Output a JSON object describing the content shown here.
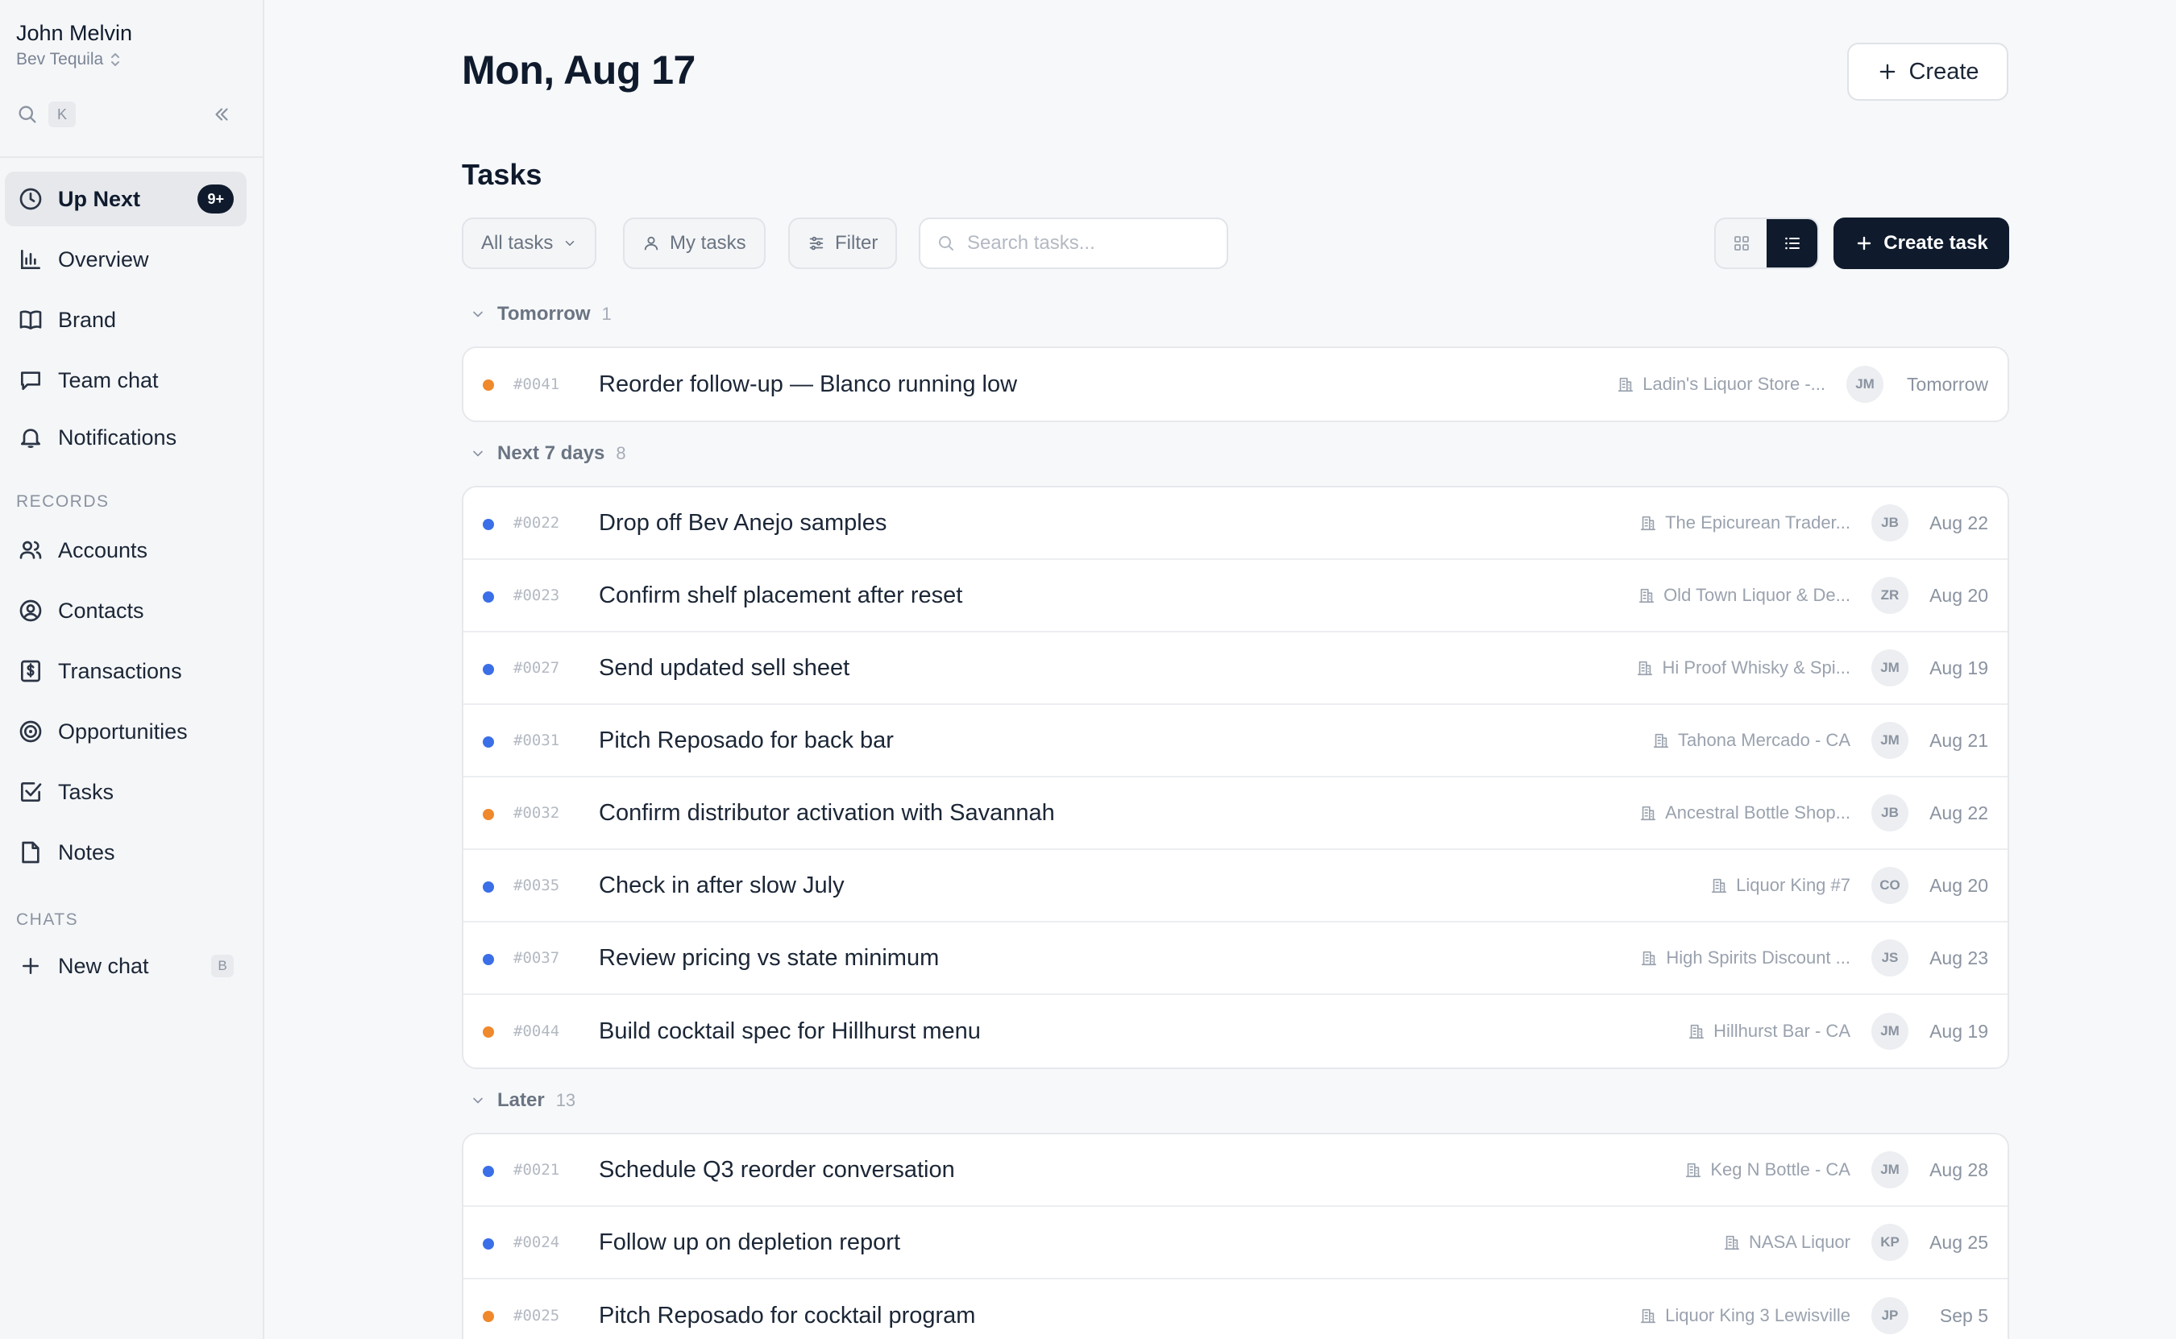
{
  "sidebar": {
    "user_name": "John Melvin",
    "workspace": "Bev Tequila",
    "search_shortcut": "K",
    "nav": [
      {
        "label": "Up Next",
        "icon": "clock-icon",
        "badge": "9+",
        "active": true
      },
      {
        "label": "Overview",
        "icon": "bar-chart-icon"
      },
      {
        "label": "Brand",
        "icon": "book-icon"
      },
      {
        "label": "Team chat",
        "icon": "chat-bubble-icon"
      },
      {
        "label": "Notifications",
        "icon": "bell-icon"
      }
    ],
    "records_label": "RECORDS",
    "records": [
      {
        "label": "Accounts",
        "icon": "users-icon"
      },
      {
        "label": "Contacts",
        "icon": "user-circle-icon"
      },
      {
        "label": "Transactions",
        "icon": "dollar-receipt-icon"
      },
      {
        "label": "Opportunities",
        "icon": "target-icon"
      },
      {
        "label": "Tasks",
        "icon": "checkbox-icon"
      },
      {
        "label": "Notes",
        "icon": "note-icon"
      }
    ],
    "chats_label": "CHATS",
    "new_chat": {
      "label": "New chat",
      "shortcut": "B"
    }
  },
  "header": {
    "date_title": "Mon, Aug 17",
    "create_label": "Create"
  },
  "tasks": {
    "title": "Tasks",
    "toolbar": {
      "all_tasks": "All tasks",
      "my_tasks": "My tasks",
      "filter": "Filter",
      "search_placeholder": "Search tasks...",
      "create_task": "Create task",
      "view_mode": "list"
    },
    "groups": [
      {
        "name": "Tomorrow",
        "count": "1",
        "rows": [
          {
            "id": "#0041",
            "title": "Reorder follow-up — Blanco running low",
            "account": "Ladin's Liquor Store -...",
            "assignee": "JM",
            "due": "Tomorrow",
            "priority": "high"
          }
        ]
      },
      {
        "name": "Next 7 days",
        "count": "8",
        "rows": [
          {
            "id": "#0022",
            "title": "Drop off Bev Anejo samples",
            "account": "The Epicurean Trader...",
            "assignee": "JB",
            "due": "Aug 22",
            "priority": "normal"
          },
          {
            "id": "#0023",
            "title": "Confirm shelf placement after reset",
            "account": "Old Town Liquor & De...",
            "assignee": "ZR",
            "due": "Aug 20",
            "priority": "normal"
          },
          {
            "id": "#0027",
            "title": "Send updated sell sheet",
            "account": "Hi Proof Whisky & Spi...",
            "assignee": "JM",
            "due": "Aug 19",
            "priority": "normal"
          },
          {
            "id": "#0031",
            "title": "Pitch Reposado for back bar",
            "account": "Tahona Mercado - CA",
            "assignee": "JM",
            "due": "Aug 21",
            "priority": "normal"
          },
          {
            "id": "#0032",
            "title": "Confirm distributor activation with Savannah",
            "account": "Ancestral Bottle Shop...",
            "assignee": "JB",
            "due": "Aug 22",
            "priority": "high"
          },
          {
            "id": "#0035",
            "title": "Check in after slow July",
            "account": "Liquor King #7",
            "assignee": "CO",
            "due": "Aug 20",
            "priority": "normal"
          },
          {
            "id": "#0037",
            "title": "Review pricing vs state minimum",
            "account": "High Spirits Discount ...",
            "assignee": "JS",
            "due": "Aug 23",
            "priority": "normal"
          },
          {
            "id": "#0044",
            "title": "Build cocktail spec for Hillhurst menu",
            "account": "Hillhurst Bar - CA",
            "assignee": "JM",
            "due": "Aug 19",
            "priority": "high"
          }
        ]
      },
      {
        "name": "Later",
        "count": "13",
        "rows": [
          {
            "id": "#0021",
            "title": "Schedule Q3 reorder conversation",
            "account": "Keg N Bottle - CA",
            "assignee": "JM",
            "due": "Aug 28",
            "priority": "normal"
          },
          {
            "id": "#0024",
            "title": "Follow up on depletion report",
            "account": "NASA Liquor",
            "assignee": "KP",
            "due": "Aug 25",
            "priority": "normal"
          },
          {
            "id": "#0025",
            "title": "Pitch Reposado for cocktail program",
            "account": "Liquor King 3 Lewisville",
            "assignee": "JP",
            "due": "Sep 5",
            "priority": "high"
          }
        ]
      }
    ]
  },
  "colors": {
    "priority_high": "#f0882c",
    "priority_normal": "#3b6fe8",
    "primary": "#0f1b2d"
  }
}
